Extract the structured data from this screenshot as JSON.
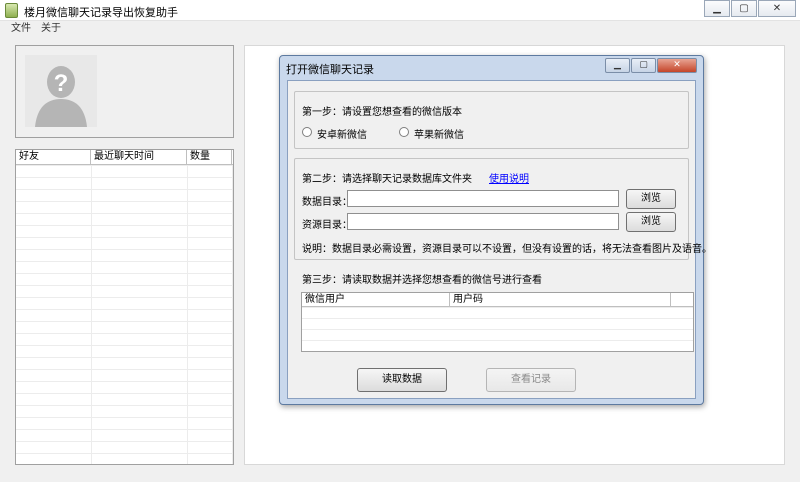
{
  "window": {
    "title": "楼月微信聊天记录导出恢复助手",
    "controls": {
      "minimize": "▁",
      "maximize": "▢",
      "close": "✕"
    }
  },
  "menu": {
    "items": [
      "文件",
      "关于"
    ]
  },
  "friend_table": {
    "columns": [
      "好友",
      "最近聊天时间",
      "数量"
    ]
  },
  "dialog": {
    "title": "打开微信聊天记录",
    "controls": {
      "minimize": "▁",
      "maximize": "▢",
      "close": "✕"
    },
    "step1": {
      "label": "第一步：请设置您想查看的微信版本",
      "options": [
        "安卓新微信",
        "苹果新微信"
      ]
    },
    "step2": {
      "label": "第二步：请选择聊天记录数据库文件夹",
      "help_link": "使用说明",
      "data_dir_label": "数据目录：",
      "data_dir_value": "",
      "res_dir_label": "资源目录：",
      "res_dir_value": "",
      "browse": "浏览",
      "note": "说明：数据目录必需设置，资源目录可以不设置，但没有设置的话，将无法查看图片及语音。"
    },
    "step3": {
      "label": "第三步：请读取数据并选择您想查看的微信号进行查看",
      "columns": [
        "微信用户",
        "用户码"
      ]
    },
    "read_button": "读取数据",
    "view_button": "查看记录"
  }
}
